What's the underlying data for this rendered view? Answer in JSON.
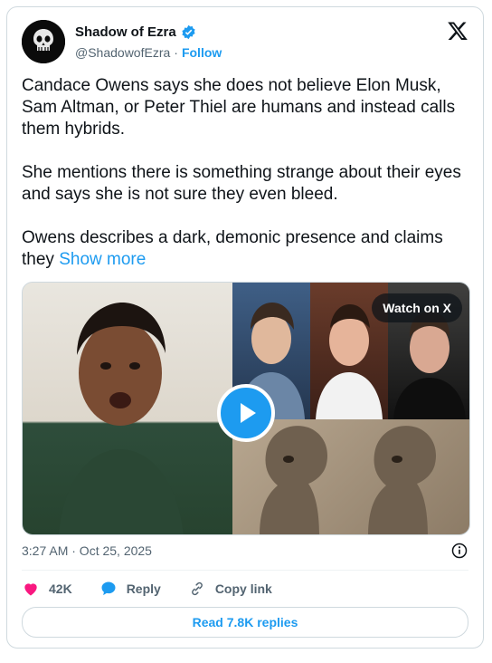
{
  "author": {
    "name": "Shadow of Ezra",
    "handle": "@ShadowofEzra",
    "separator": "·",
    "follow_label": "Follow"
  },
  "tweet": {
    "paragraphs": [
      "Candace Owens says she does not believe Elon Musk, Sam Altman, or Peter Thiel are humans and instead calls them hybrids.",
      "She mentions there is something strange about their eyes and says she is not sure they even bleed."
    ],
    "last_paragraph": "Owens describes a dark, demonic presence and claims they",
    "show_more_label": "Show more"
  },
  "media": {
    "watch_label": "Watch on X"
  },
  "meta": {
    "timestamp": "3:27 AM · Oct 25, 2025"
  },
  "actions": {
    "likes": "42K",
    "reply_label": "Reply",
    "copy_link_label": "Copy link"
  },
  "read_replies_label": "Read 7.8K replies",
  "colors": {
    "accent": "#1d9bf0",
    "like": "#f91880",
    "text_secondary": "#536471"
  }
}
